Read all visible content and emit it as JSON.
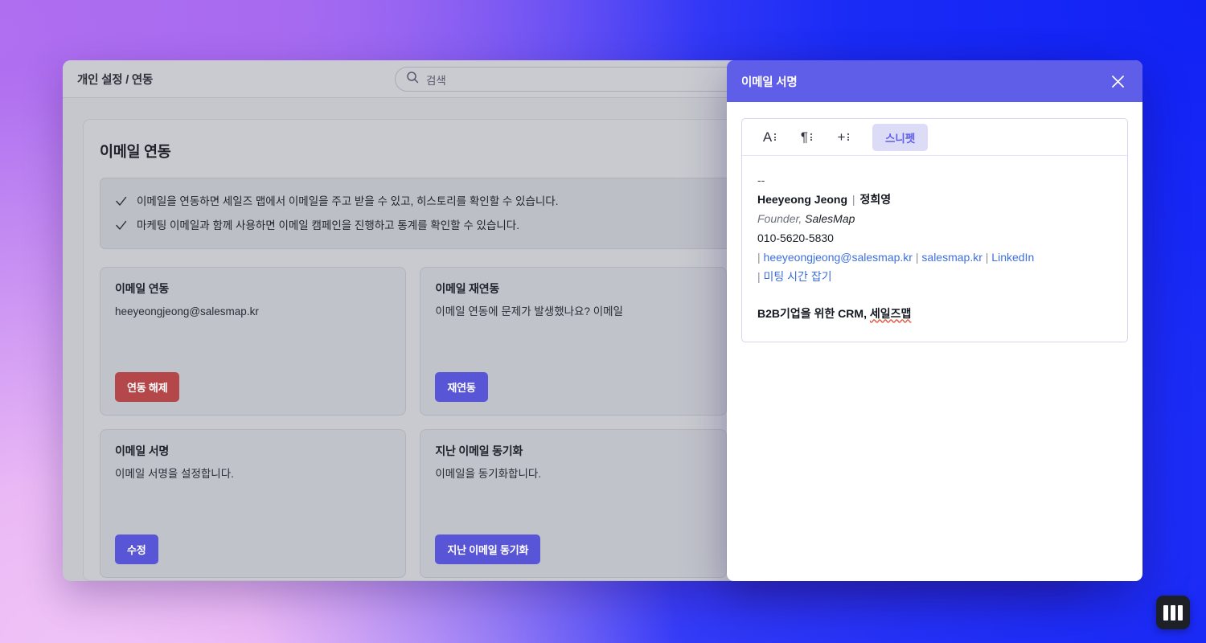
{
  "window": {
    "breadcrumb": "개인 설정 / 연동",
    "search": {
      "placeholder": "검색",
      "icon": "search-icon"
    },
    "panel": {
      "title": "이메일 연동",
      "notices": [
        "이메일을 연동하면 세일즈 맵에서 이메일을 주고 받을 수 있고, 히스토리를 확인할 수 있습니다.",
        "마케팅 이메일과 함께 사용하면 이메일 캠페인을 진행하고 통계를 확인할 수 있습니다."
      ],
      "cards": [
        {
          "title": "이메일 연동",
          "desc": "heeyeongjeong@salesmap.kr",
          "button": "연동 해제",
          "button_style": "danger"
        },
        {
          "title": "이메일 재연동",
          "desc": "이메일 연동에 문제가 발생했나요? 이메일",
          "button": "재연동",
          "button_style": "primary"
        },
        {
          "title": "이메일 서명",
          "desc": "이메일 서명을 설정합니다.",
          "button": "수정",
          "button_style": "primary"
        },
        {
          "title": "지난 이메일 동기화",
          "desc": "이메일을 동기화합니다.",
          "button": "지난 이메일 동기화",
          "button_style": "primary"
        }
      ]
    }
  },
  "modal": {
    "title": "이메일 서명",
    "close_icon": "close-icon",
    "toolbar": {
      "text_format_label": "A",
      "paragraph_label": "¶",
      "insert_label": "+",
      "snippet_label": "스니펫"
    },
    "signature": {
      "dashes": "--",
      "name_en": "Heeyeong Jeong",
      "name_separator": "|",
      "name_ko": "정희영",
      "role_prefix": "Founder,",
      "role_company": "SalesMap",
      "phone": "010-5620-5830",
      "link_email": "heeyeongjeong@salesmap.kr",
      "link_site": "salesmap.kr",
      "link_linkedin": "LinkedIn",
      "link_meeting": "미팅 시간 잡기",
      "pipe": "|",
      "tagline_plain": "B2B기업을 위한 CRM, ",
      "tagline_spell": "세일즈맵"
    }
  },
  "widget": {
    "icon": "columns-icon"
  },
  "colors": {
    "accent": "#5f5ee8",
    "danger": "#b4474a",
    "link": "#3d6fe0",
    "chip_bg": "#dcdcf7"
  }
}
